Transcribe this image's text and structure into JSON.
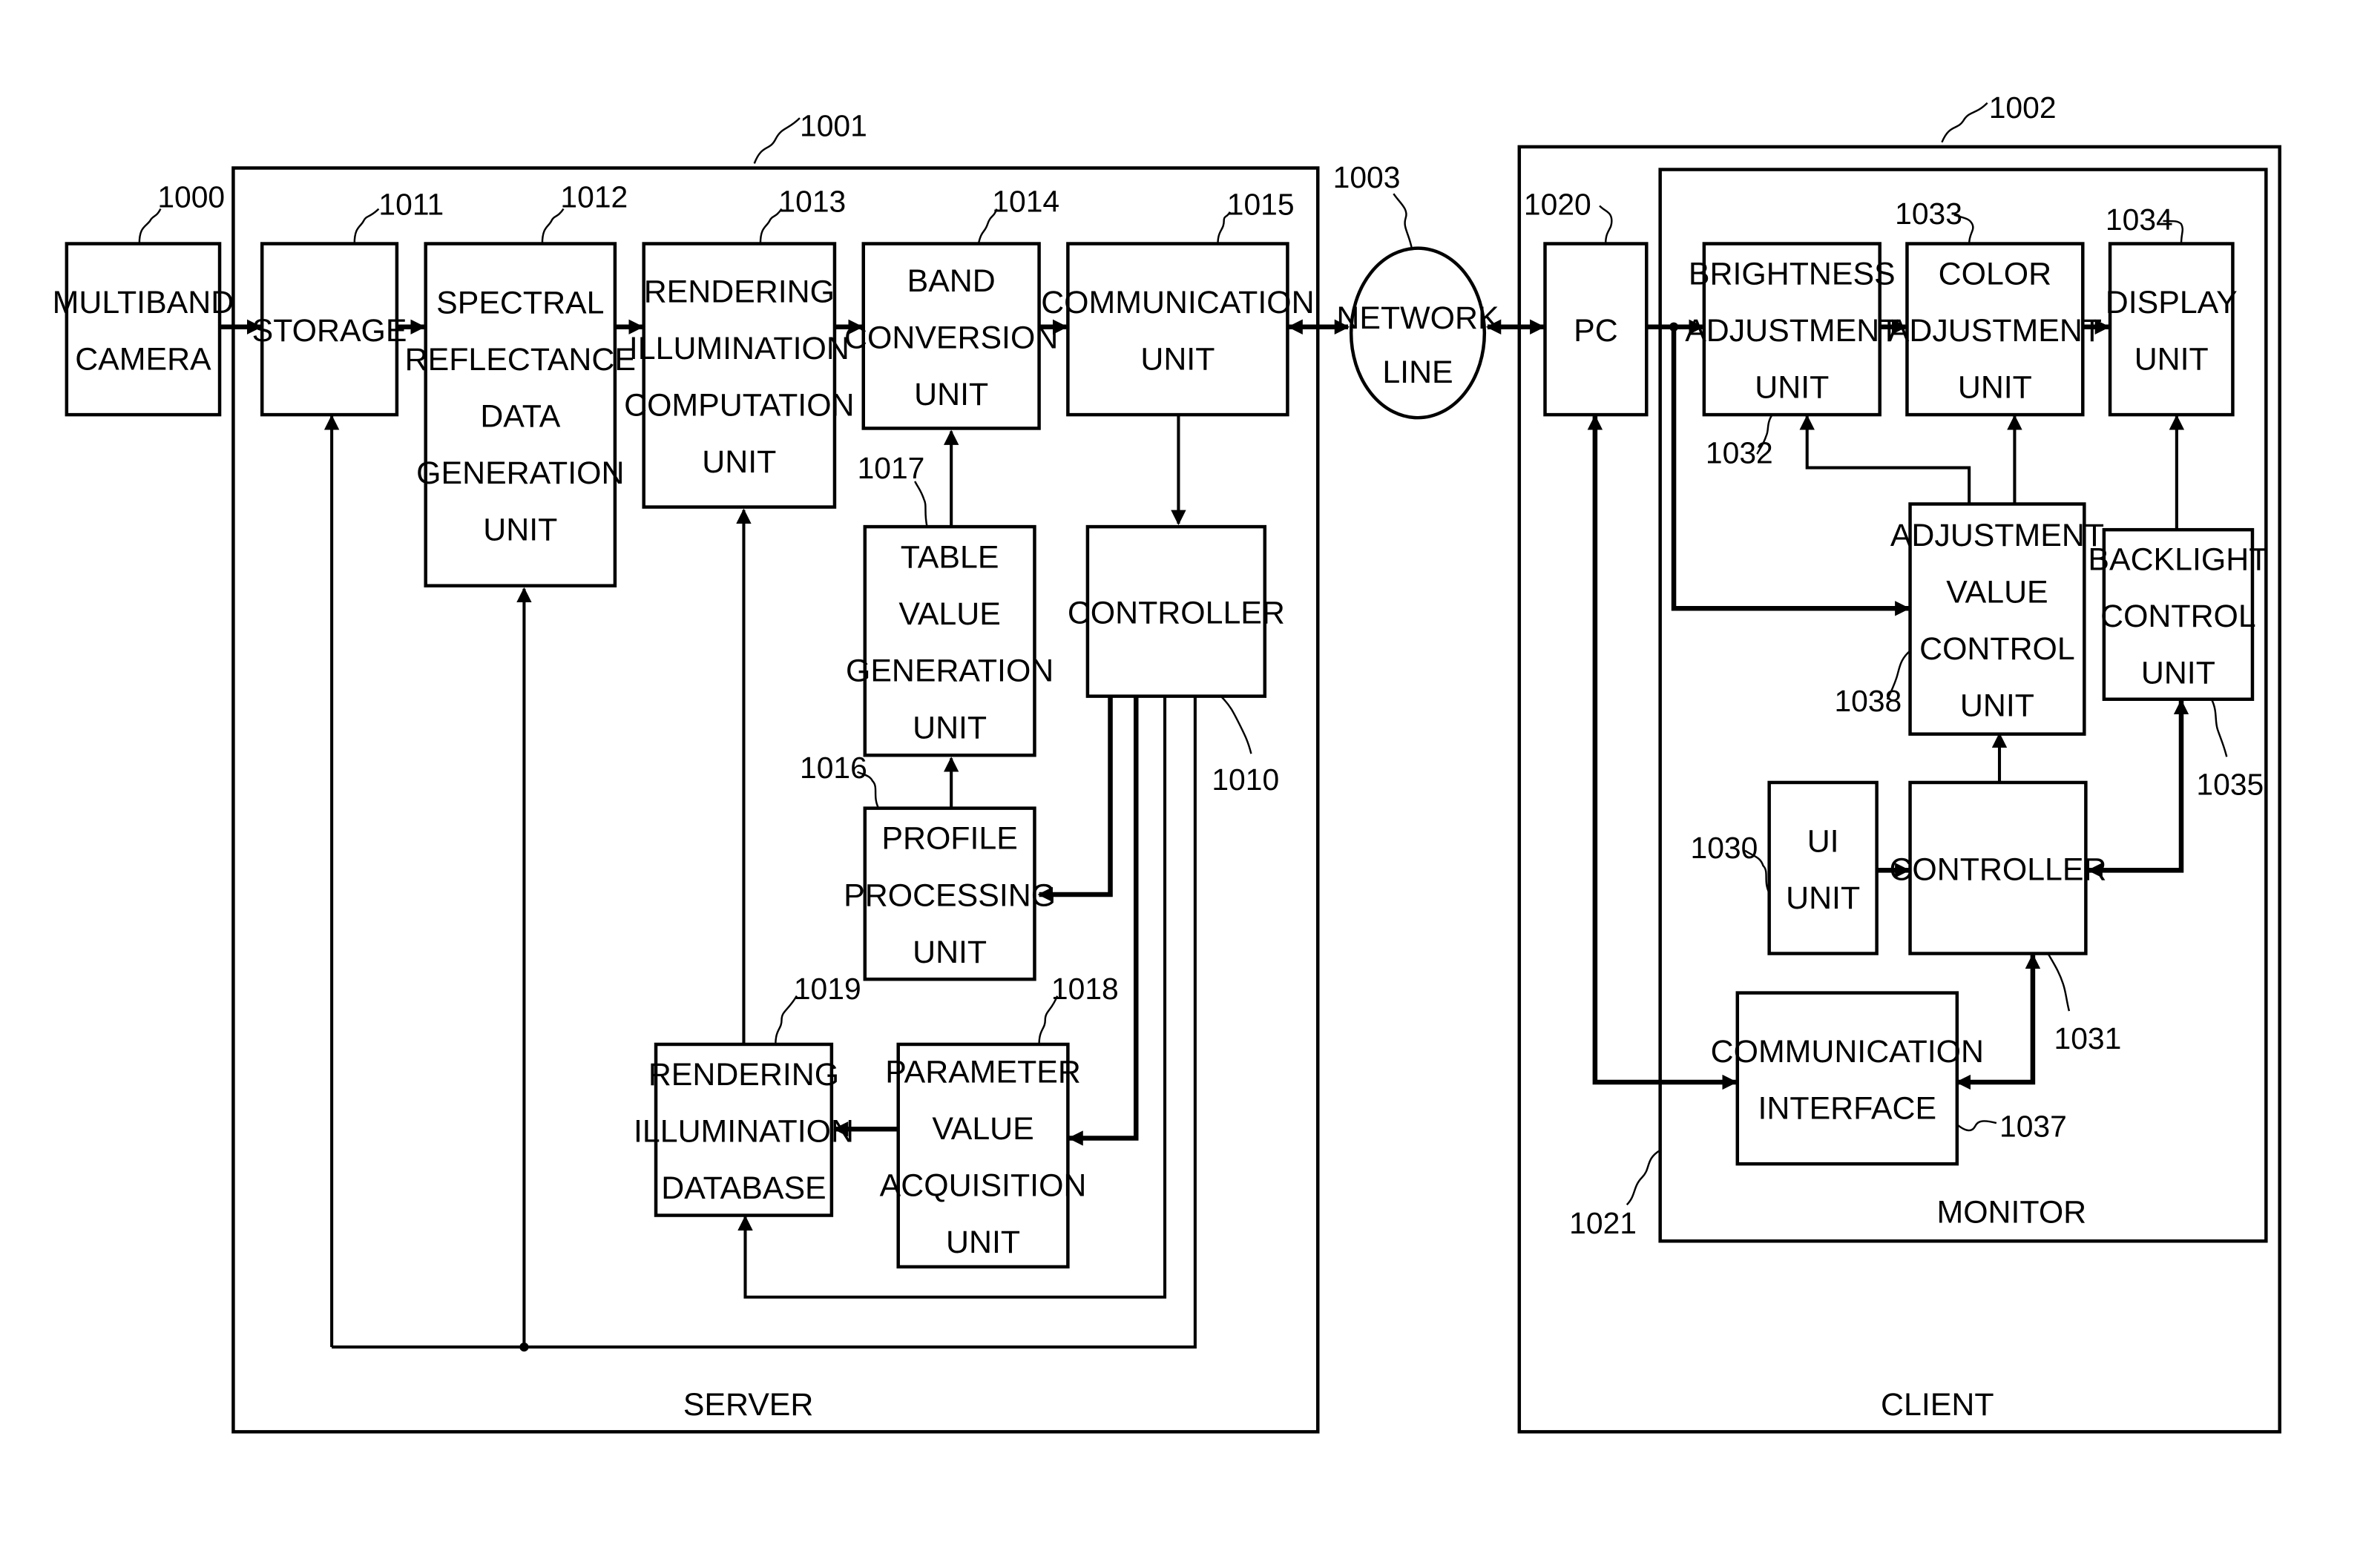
{
  "diagram": {
    "type": "block-diagram",
    "regions": {
      "server": {
        "label": "SERVER",
        "ref": "1001"
      },
      "client": {
        "label": "CLIENT",
        "ref": "1002"
      },
      "monitor": {
        "label": "MONITOR",
        "ref": "1021"
      }
    },
    "blocks": {
      "multiband_camera": {
        "lines": [
          "MULTIBAND",
          "CAMERA"
        ],
        "ref": "1000"
      },
      "storage": {
        "lines": [
          "STORAGE"
        ],
        "ref": "1011"
      },
      "spectral_reflectance": {
        "lines": [
          "SPECTRAL",
          "REFLECTANCE",
          "DATA",
          "GENERATION",
          "UNIT"
        ],
        "ref": "1012"
      },
      "rendering_illumination_computation": {
        "lines": [
          "RENDERING",
          "ILLUMINATION",
          "COMPUTATION",
          "UNIT"
        ],
        "ref": "1013"
      },
      "band_conversion": {
        "lines": [
          "BAND",
          "CONVERSION",
          "UNIT"
        ],
        "ref": "1014"
      },
      "communication_unit": {
        "lines": [
          "COMMUNICATION",
          "UNIT"
        ],
        "ref": "1015"
      },
      "table_value_generation": {
        "lines": [
          "TABLE",
          "VALUE",
          "GENERATION",
          "UNIT"
        ],
        "ref": "1017"
      },
      "server_controller": {
        "lines": [
          "CONTROLLER"
        ],
        "ref": "1010"
      },
      "profile_processing": {
        "lines": [
          "PROFILE",
          "PROCESSING",
          "UNIT"
        ],
        "ref": "1016"
      },
      "rendering_illumination_database": {
        "lines": [
          "RENDERING",
          "ILLUMINATION",
          "DATABASE"
        ],
        "ref": "1019"
      },
      "parameter_value_acquisition": {
        "lines": [
          "PARAMETER",
          "VALUE",
          "ACQUISITION",
          "UNIT"
        ],
        "ref": "1018"
      },
      "network_line": {
        "lines": [
          "NETWORK",
          "LINE"
        ],
        "ref": "1003"
      },
      "pc": {
        "lines": [
          "PC"
        ],
        "ref": "1020"
      },
      "brightness_adjustment": {
        "lines": [
          "BRIGHTNESS",
          "ADJUSTMENT",
          "UNIT"
        ],
        "ref": "1032"
      },
      "color_adjustment": {
        "lines": [
          "COLOR",
          "ADJUSTMENT",
          "UNIT"
        ],
        "ref": "1033"
      },
      "display_unit": {
        "lines": [
          "DISPLAY",
          "UNIT"
        ],
        "ref": "1034"
      },
      "adjustment_value_control": {
        "lines": [
          "ADJUSTMENT",
          "VALUE",
          "CONTROL",
          "UNIT"
        ],
        "ref": "1038"
      },
      "backlight_control": {
        "lines": [
          "BACKLIGHT",
          "CONTROL",
          "UNIT"
        ],
        "ref": "1035"
      },
      "ui_unit": {
        "lines": [
          "UI",
          "UNIT"
        ],
        "ref": "1030"
      },
      "monitor_controller": {
        "lines": [
          "CONTROLLER"
        ],
        "ref": "1031"
      },
      "communication_interface": {
        "lines": [
          "COMMUNICATION",
          "INTERFACE"
        ],
        "ref": "1037"
      }
    },
    "connections": [
      {
        "from": "multiband_camera",
        "to": "storage",
        "direction": "forward"
      },
      {
        "from": "storage",
        "to": "spectral_reflectance",
        "direction": "forward"
      },
      {
        "from": "spectral_reflectance",
        "to": "rendering_illumination_computation",
        "direction": "forward"
      },
      {
        "from": "rendering_illumination_computation",
        "to": "band_conversion",
        "direction": "forward"
      },
      {
        "from": "band_conversion",
        "to": "communication_unit",
        "direction": "forward"
      },
      {
        "from": "communication_unit",
        "to": "network_line",
        "direction": "bidirectional"
      },
      {
        "from": "network_line",
        "to": "pc",
        "direction": "bidirectional"
      },
      {
        "from": "communication_unit",
        "to": "server_controller",
        "direction": "forward"
      },
      {
        "from": "table_value_generation",
        "to": "band_conversion",
        "direction": "forward"
      },
      {
        "from": "profile_processing",
        "to": "table_value_generation",
        "direction": "forward"
      },
      {
        "from": "server_controller",
        "to": "profile_processing",
        "direction": "forward"
      },
      {
        "from": "server_controller",
        "to": "parameter_value_acquisition",
        "direction": "forward"
      },
      {
        "from": "server_controller",
        "to": "rendering_illumination_database",
        "direction": "forward"
      },
      {
        "from": "server_controller",
        "to": "storage",
        "direction": "forward"
      },
      {
        "from": "server_controller",
        "to": "spectral_reflectance",
        "direction": "forward"
      },
      {
        "from": "parameter_value_acquisition",
        "to": "rendering_illumination_database",
        "direction": "forward"
      },
      {
        "from": "rendering_illumination_database",
        "to": "rendering_illumination_computation",
        "direction": "forward"
      },
      {
        "from": "pc",
        "to": "brightness_adjustment",
        "direction": "forward"
      },
      {
        "from": "pc",
        "to": "adjustment_value_control",
        "direction": "forward"
      },
      {
        "from": "brightness_adjustment",
        "to": "color_adjustment",
        "direction": "forward"
      },
      {
        "from": "color_adjustment",
        "to": "display_unit",
        "direction": "forward"
      },
      {
        "from": "adjustment_value_control",
        "to": "brightness_adjustment",
        "direction": "forward"
      },
      {
        "from": "adjustment_value_control",
        "to": "color_adjustment",
        "direction": "forward"
      },
      {
        "from": "backlight_control",
        "to": "display_unit",
        "direction": "forward"
      },
      {
        "from": "ui_unit",
        "to": "monitor_controller",
        "direction": "forward"
      },
      {
        "from": "monitor_controller",
        "to": "adjustment_value_control",
        "direction": "forward"
      },
      {
        "from": "monitor_controller",
        "to": "backlight_control",
        "direction": "bidirectional"
      },
      {
        "from": "communication_interface",
        "to": "monitor_controller",
        "direction": "bidirectional"
      },
      {
        "from": "pc",
        "to": "communication_interface",
        "direction": "bidirectional"
      }
    ]
  }
}
